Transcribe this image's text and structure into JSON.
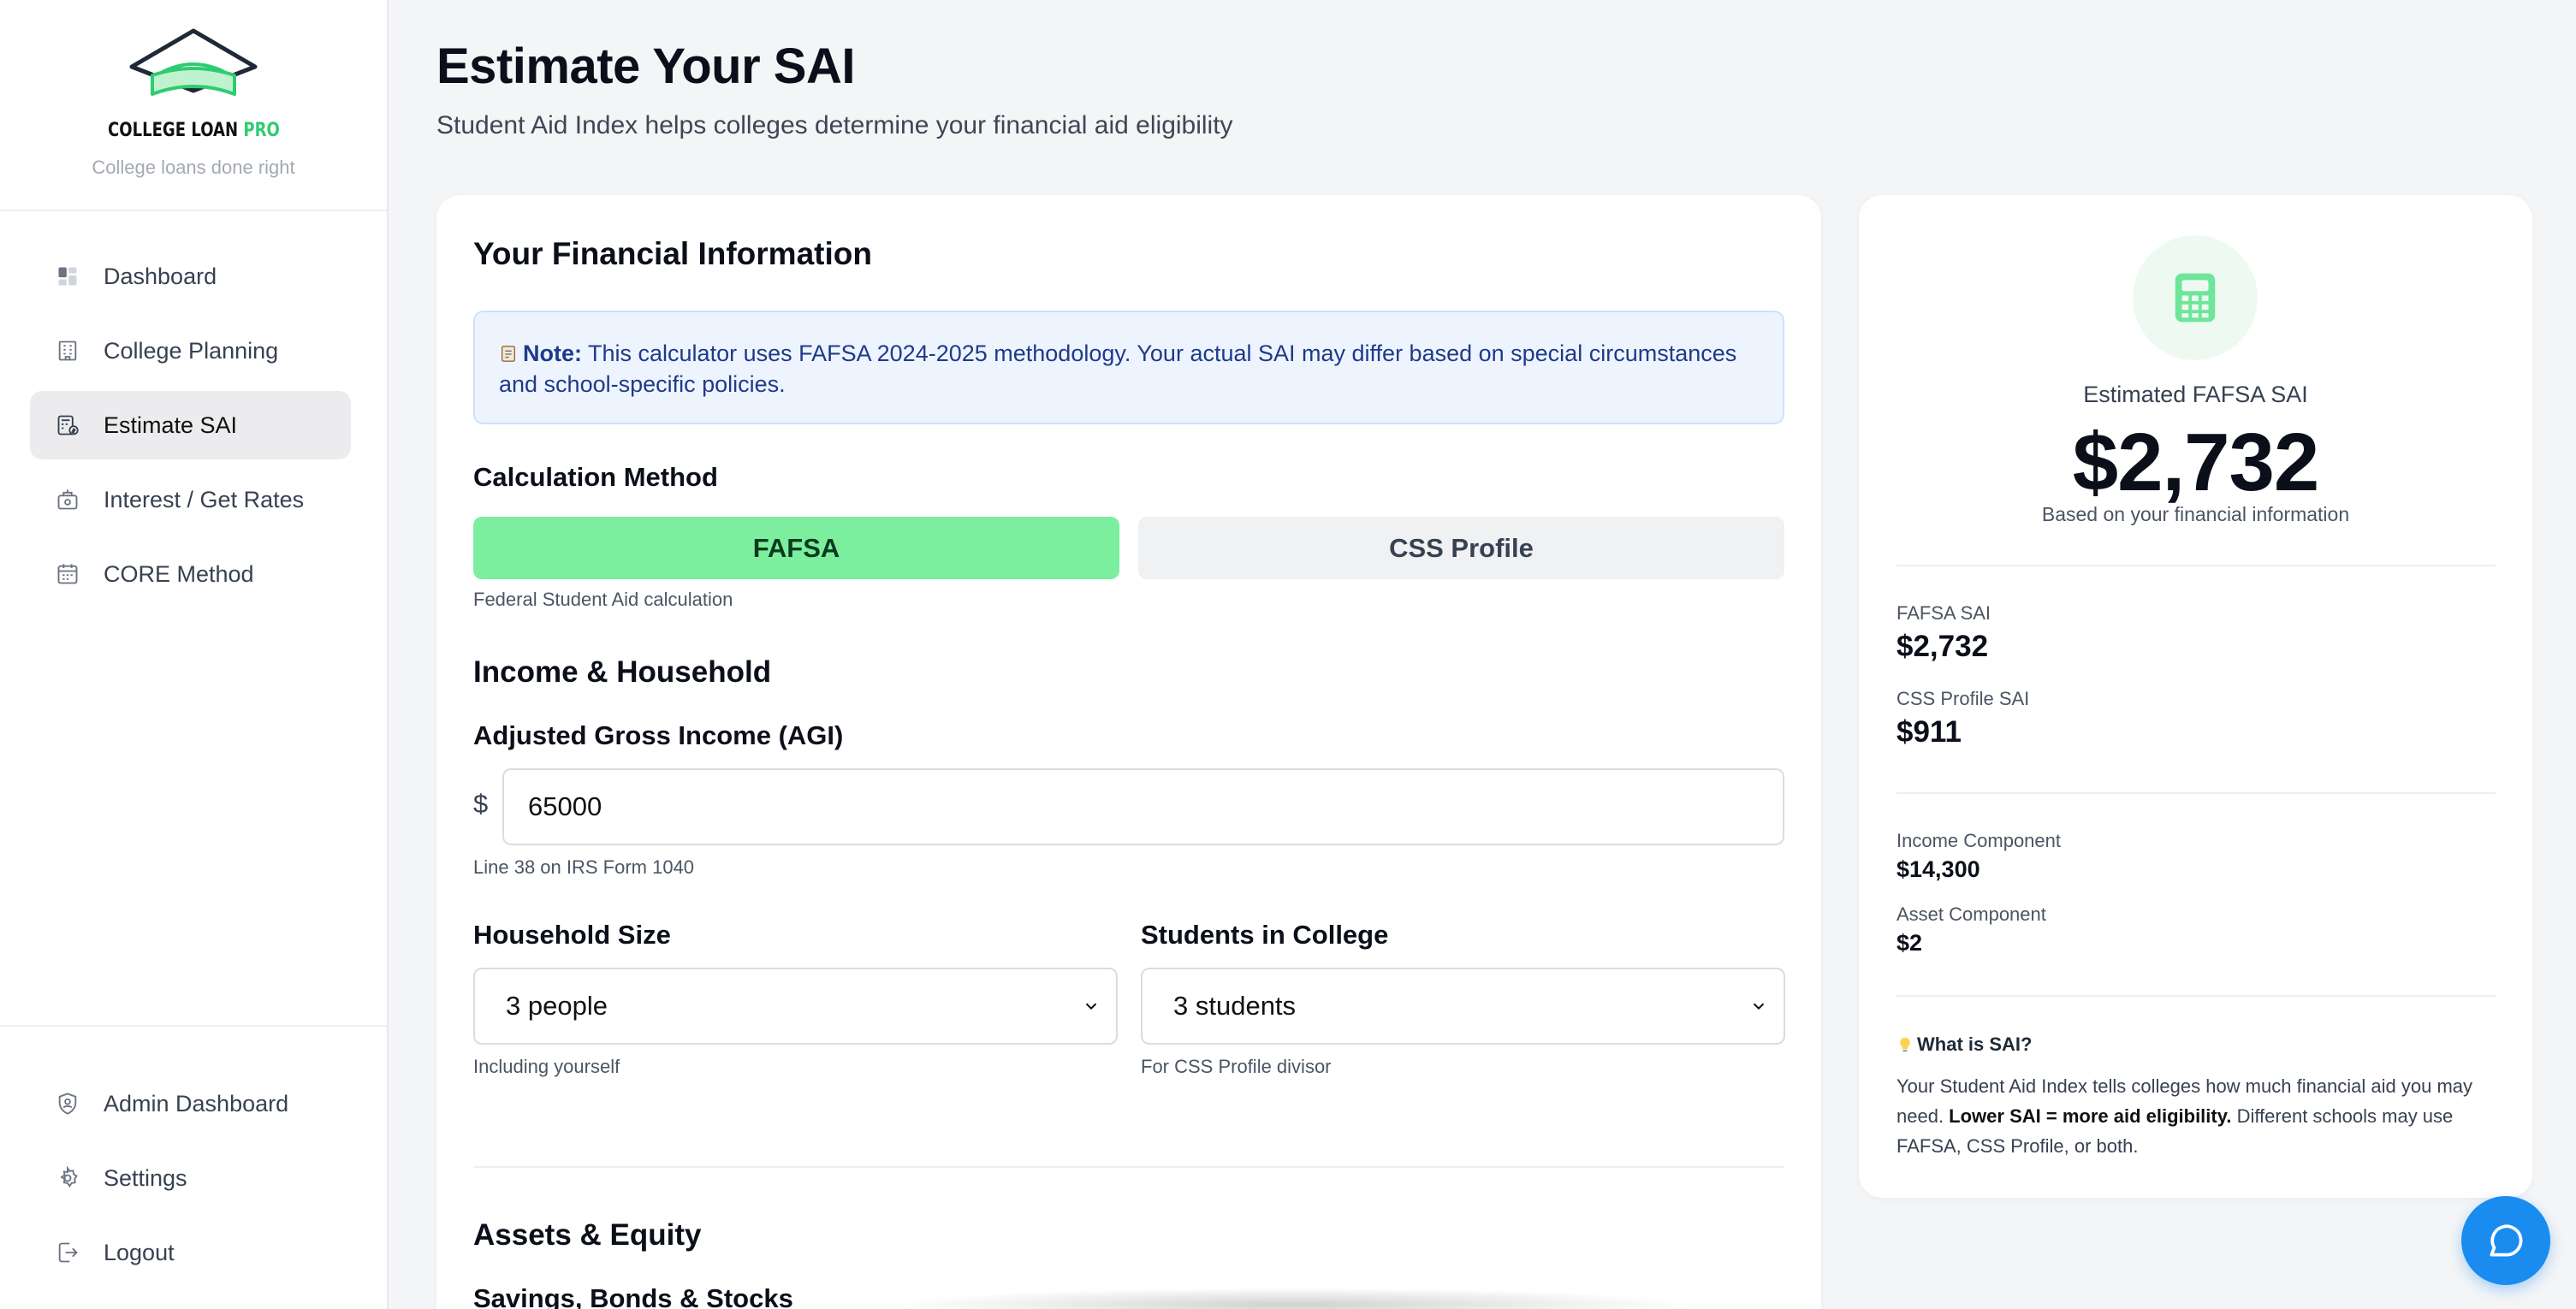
{
  "brand": {
    "name_main": "COLLEGE LOAN",
    "name_accent": "PRO",
    "tagline": "College loans done right"
  },
  "sidebar": {
    "items": [
      {
        "label": "Dashboard",
        "icon": "dashboard-icon"
      },
      {
        "label": "College Planning",
        "icon": "building-icon"
      },
      {
        "label": "Estimate SAI",
        "icon": "calculator-dollar-icon",
        "active": true
      },
      {
        "label": "Interest / Get Rates",
        "icon": "money-box-icon"
      },
      {
        "label": "CORE Method",
        "icon": "calendar-grid-icon"
      }
    ],
    "bottom_items": [
      {
        "label": "Admin Dashboard",
        "icon": "shield-user-icon"
      },
      {
        "label": "Settings",
        "icon": "gear-icon"
      },
      {
        "label": "Logout",
        "icon": "logout-icon"
      }
    ]
  },
  "header": {
    "title": "Estimate Your SAI",
    "subtitle": "Student Aid Index helps colleges determine your financial aid eligibility"
  },
  "form": {
    "title": "Your Financial Information",
    "note_prefix": "Note:",
    "note_text": " This calculator uses FAFSA 2024-2025 methodology. Your actual SAI may differ based on special circumstances and school-specific policies.",
    "calc_method_label": "Calculation Method",
    "method_fafsa": "FAFSA",
    "method_css": "CSS Profile",
    "method_hint": "Federal Student Aid calculation",
    "income_section": "Income & Household",
    "agi_label": "Adjusted Gross Income (AGI)",
    "currency_symbol": "$",
    "agi_value": "65000",
    "agi_hint": "Line 38 on IRS Form 1040",
    "household_label": "Household Size",
    "household_value": "3 people",
    "household_hint": "Including yourself",
    "students_label": "Students in College",
    "students_value": "3 students",
    "students_hint": "For CSS Profile divisor",
    "assets_section": "Assets & Equity",
    "savings_label": "Savings, Bonds & Stocks"
  },
  "summary": {
    "est_label": "Estimated FAFSA SAI",
    "est_value": "$2,732",
    "est_sub": "Based on your financial information",
    "fafsa_label": "FAFSA SAI",
    "fafsa_value": "$2,732",
    "css_label": "CSS Profile SAI",
    "css_value": "$911",
    "income_comp_label": "Income Component",
    "income_comp_value": "$14,300",
    "asset_comp_label": "Asset Component",
    "asset_comp_value": "$2",
    "what_title": "What is SAI?",
    "what_text_1": "Your Student Aid Index tells colleges how much financial aid you may need. ",
    "what_text_bold": "Lower SAI = more aid eligibility.",
    "what_text_2": " Different schools may use FAFSA, CSS Profile, or both."
  },
  "colors": {
    "accent_green": "#7cef9e",
    "brand_green": "#2ecc71",
    "chat_blue": "#1a8cf0",
    "note_bg": "#eef4fe"
  }
}
